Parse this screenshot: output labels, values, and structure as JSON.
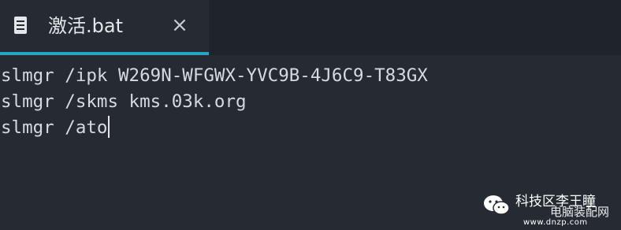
{
  "tab": {
    "title": "激活.bat",
    "icon": "file-icon",
    "close_symbol": "×",
    "accent_color": "#27a6c4"
  },
  "editor": {
    "lines": [
      "slmgr /ipk W269N-WFGWX-YVC9B-4J6C9-T83GX",
      "slmgr /skms kms.03k.org",
      "slmgr /ato"
    ]
  },
  "watermark": {
    "icon": "wechat-icon",
    "text": "科技区李王瞳",
    "overlay_text": "电脑装配网",
    "url": "www.dnzp.com"
  }
}
